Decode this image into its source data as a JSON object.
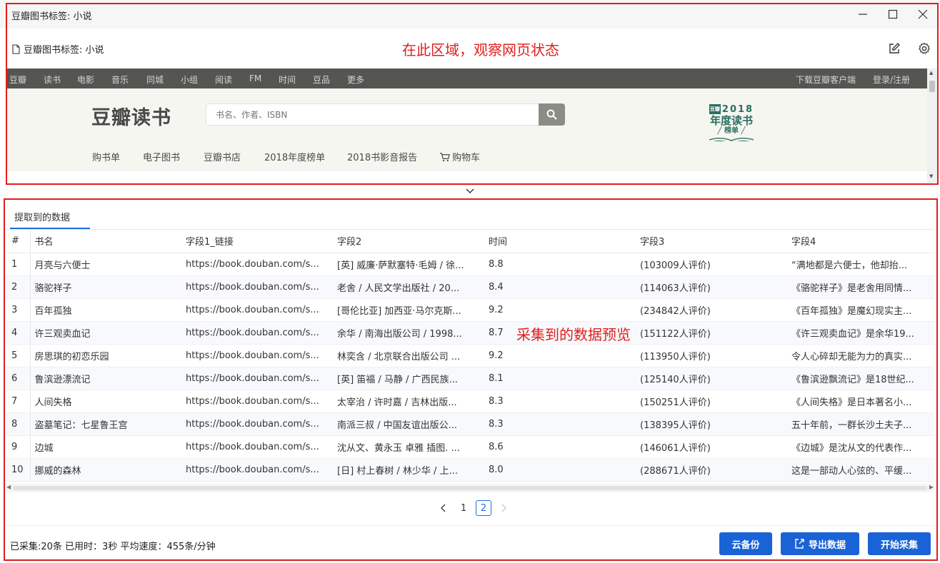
{
  "window": {
    "title": "豆瓣图书标签: 小说"
  },
  "toolbar": {
    "page_label": "豆瓣图书标签: 小说",
    "annotation": "在此区域，观察网页状态"
  },
  "douban_nav": {
    "left": [
      "豆瓣",
      "读书",
      "电影",
      "音乐",
      "同城",
      "小组",
      "阅读",
      "FM",
      "时间",
      "豆品",
      "更多"
    ],
    "right": [
      "下载豆瓣客户端",
      "登录/注册"
    ]
  },
  "book_header": {
    "logo": "豆瓣读书",
    "search_placeholder": "书名、作者、ISBN",
    "annual_tag": "豆瓣",
    "annual_year": "2018",
    "annual_title": "年度读书",
    "annual_sub": "榜单"
  },
  "subnav": {
    "items": [
      "购书单",
      "电子图书",
      "豆瓣书店",
      "2018年度榜单",
      "2018书影音报告",
      "购物车"
    ]
  },
  "data_panel": {
    "tab_label": "提取到的数据",
    "annotation": "采集到的数据预览",
    "columns": [
      "#",
      "书名",
      "字段1_链接",
      "字段2",
      "时间",
      "字段3",
      "字段4"
    ],
    "rows": [
      [
        "1",
        "月亮与六便士",
        "https://book.douban.com/s...",
        "[英] 威廉·萨默塞特·毛姆 / 徐...",
        "8.8",
        "(103009人评价)",
        "“满地都是六便士，他却抬..."
      ],
      [
        "2",
        "骆驼祥子",
        "https://book.douban.com/s...",
        "老舍 / 人民文学出版社 / 20...",
        "8.4",
        "(114063人评价)",
        "《骆驼祥子》是老舍用同情..."
      ],
      [
        "3",
        "百年孤独",
        "https://book.douban.com/s...",
        "[哥伦比亚] 加西亚·马尔克斯...",
        "9.2",
        "(234842人评价)",
        "《百年孤独》是魔幻现实主..."
      ],
      [
        "4",
        "许三观卖血记",
        "https://book.douban.com/s...",
        "余华 / 南海出版公司 / 1998...",
        "8.7",
        "(151122人评价)",
        "《许三观卖血记》是余华19..."
      ],
      [
        "5",
        "房思琪的初恋乐园",
        "https://book.douban.com/s...",
        "林奕含 / 北京联合出版公司 ...",
        "9.2",
        "(113950人评价)",
        "令人心碎却无能为力的真实..."
      ],
      [
        "6",
        "鲁滨逊漂流记",
        "https://book.douban.com/s...",
        "[英] 笛福 / 马静 / 广西民族...",
        "8.1",
        "(125140人评价)",
        "《鲁滨逊飘流记》是18世纪..."
      ],
      [
        "7",
        "人间失格",
        "https://book.douban.com/s...",
        "太宰治 / 许时嘉 / 吉林出版...",
        "8.3",
        "(150251人评价)",
        "《人间失格》是日本著名小..."
      ],
      [
        "8",
        "盗墓笔记：七星鲁王宫",
        "https://book.douban.com/s...",
        "南派三叔 / 中国友谊出版公...",
        "8.3",
        "(138395人评价)",
        "五十年前，一群长沙土夫子..."
      ],
      [
        "9",
        "边城",
        "https://book.douban.com/s...",
        "沈从文、黄永玉 卓雅 插图. ...",
        "8.6",
        "(146061人评价)",
        "《边城》是沈从文的代表作..."
      ],
      [
        "10",
        "挪威的森林",
        "https://book.douban.com/s...",
        "[日] 村上春树 / 林少华 / 上...",
        "8.0",
        "(288671人评价)",
        "这是一部动人心弦的、平缓..."
      ]
    ]
  },
  "pagination": {
    "pages": [
      "1",
      "2"
    ],
    "current": "2"
  },
  "footer": {
    "status": "已采集:20条 已用时：3秒 平均速度：455条/分钟",
    "cloud_backup": "云备份",
    "export": "导出数据",
    "start": "开始采集"
  },
  "colors": {
    "annotation_red": "#e21d1d",
    "primary_blue": "#1a63d6",
    "douban_nav_bg": "#545652",
    "douban_header_bg": "#f6f6f1",
    "annual_green": "#2a6e61"
  },
  "icons": [
    "minimize-icon",
    "maximize-icon",
    "close-icon",
    "document-icon",
    "edit-icon",
    "gear-icon",
    "search-icon",
    "cart-icon",
    "chevron-down-icon",
    "chevron-left-icon",
    "chevron-right-icon",
    "export-icon"
  ]
}
